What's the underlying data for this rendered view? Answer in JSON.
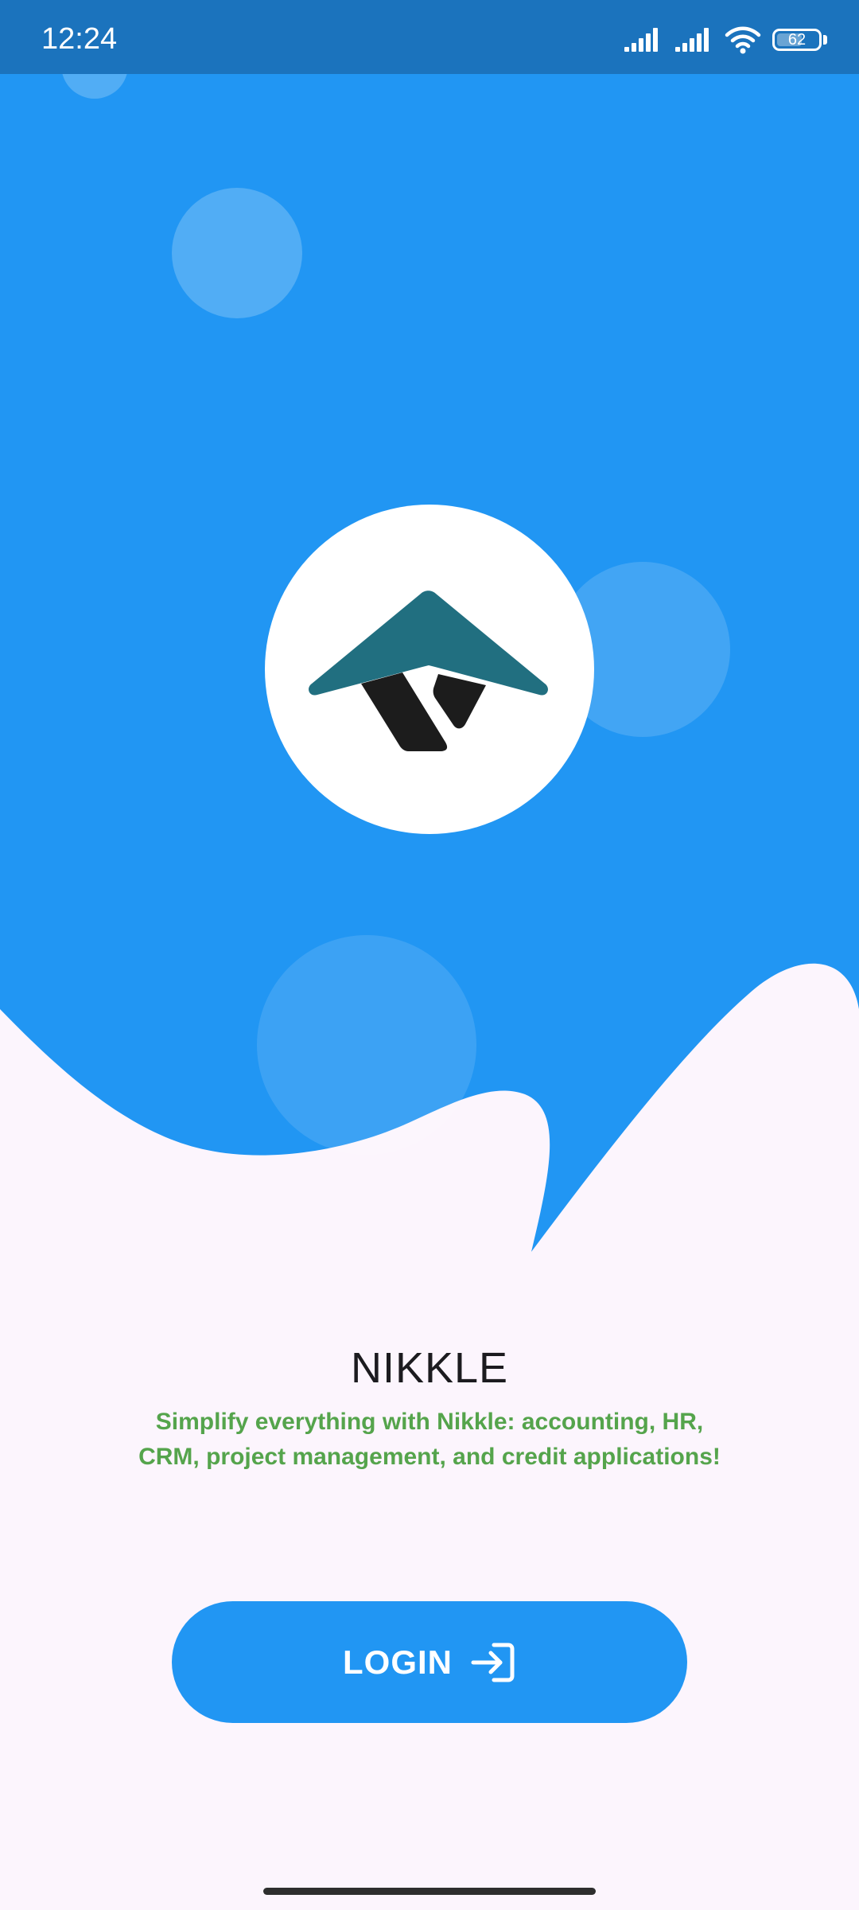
{
  "status_bar": {
    "time": "12:24",
    "battery_level": "62",
    "battery_fraction": 0.62,
    "icons": [
      "signal-icon",
      "signal-icon",
      "wifi-icon",
      "battery-icon"
    ]
  },
  "splash": {
    "logo_icon": "nikkle-house-logo",
    "title": "NIKKLE",
    "tagline": "Simplify everything with Nikkle: accounting, HR, CRM, project management, and credit applications!"
  },
  "login": {
    "label": "LOGIN",
    "icon": "login-arrow-icon"
  },
  "colors": {
    "primary": "#2196f3",
    "status_bar": "#1b73bd",
    "background": "#fcf5fd",
    "logo_teal": "#216f80",
    "logo_dark": "#1c1c1c",
    "tagline": "#55a44c",
    "title": "#1c1b1f"
  }
}
